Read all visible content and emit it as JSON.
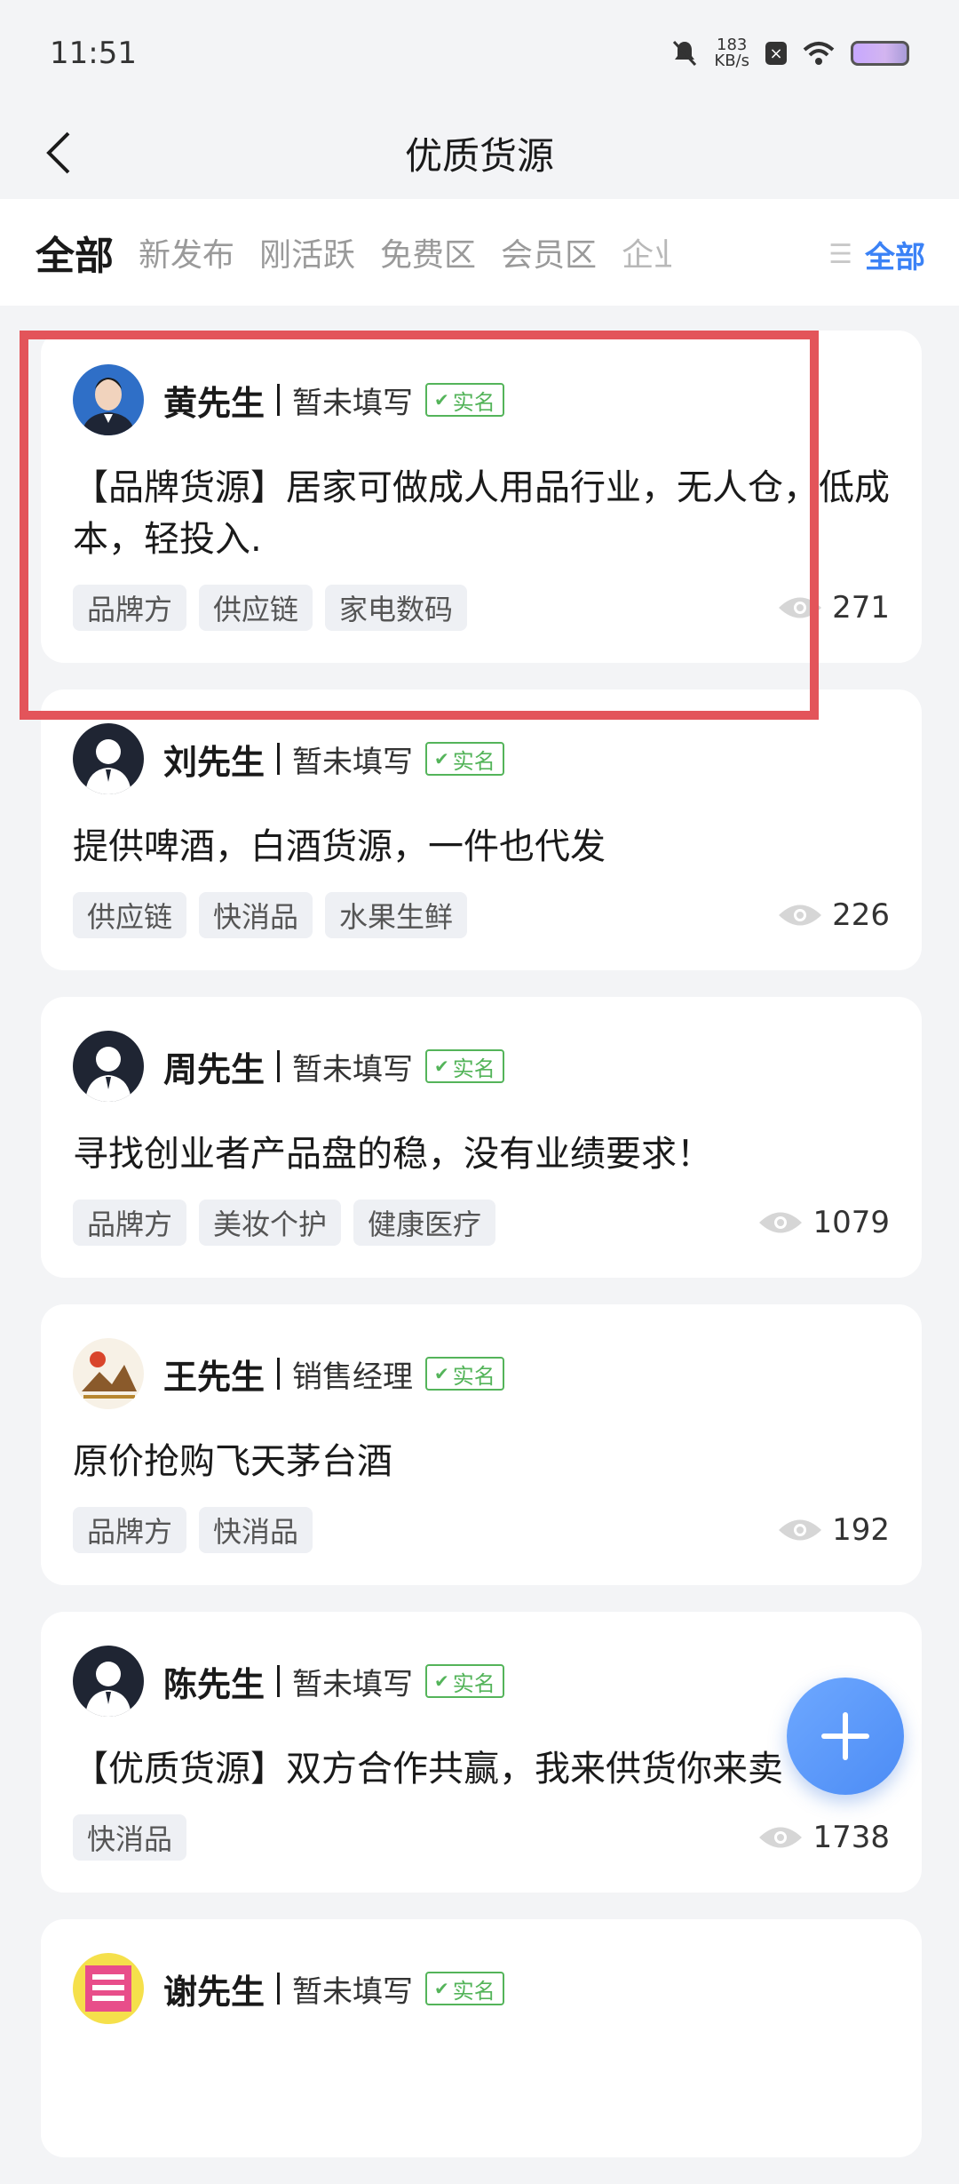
{
  "status": {
    "time": "11:51",
    "net_speed_value": "183",
    "net_speed_unit": "KB/s"
  },
  "nav": {
    "title": "优质货源"
  },
  "tabs": {
    "items": [
      "全部",
      "新发布",
      "刚活跃",
      "免费区",
      "会员区",
      "企业"
    ],
    "active_index": 0,
    "filter_label": "全部"
  },
  "verified_label": "实名",
  "colors": {
    "accent": "#3b82f6",
    "verified": "#54b45a",
    "highlight": "#e3545a"
  },
  "cards": [
    {
      "name": "黄先生",
      "role": "暂未填写",
      "content": "【品牌货源】居家可做成人用品行业，无人仓，低成本，轻投入.",
      "tags": [
        "品牌方",
        "供应链",
        "家电数码"
      ],
      "views": "271",
      "avatar": "photo-icon"
    },
    {
      "name": "刘先生",
      "role": "暂未填写",
      "content": "提供啤酒，白酒货源，一件也代发",
      "tags": [
        "供应链",
        "快消品",
        "水果生鲜"
      ],
      "views": "226",
      "avatar": "default-user-icon"
    },
    {
      "name": "周先生",
      "role": "暂未填写",
      "content": "寻找创业者产品盘的稳，没有业绩要求！",
      "tags": [
        "品牌方",
        "美妆个护",
        "健康医疗"
      ],
      "views": "1079",
      "avatar": "default-user-icon"
    },
    {
      "name": "王先生",
      "role": "销售经理",
      "content": "原价抢购飞天茅台酒",
      "tags": [
        "品牌方",
        "快消品"
      ],
      "views": "192",
      "avatar": "logo-icon"
    },
    {
      "name": "陈先生",
      "role": "暂未填写",
      "content": "【优质货源】双方合作共赢，我来供货你来卖",
      "tags": [
        "快消品"
      ],
      "views": "1738",
      "avatar": "default-user-icon"
    },
    {
      "name": "谢先生",
      "role": "暂未填写",
      "content": "",
      "tags": [],
      "views": "",
      "avatar": "logo-icon"
    }
  ]
}
